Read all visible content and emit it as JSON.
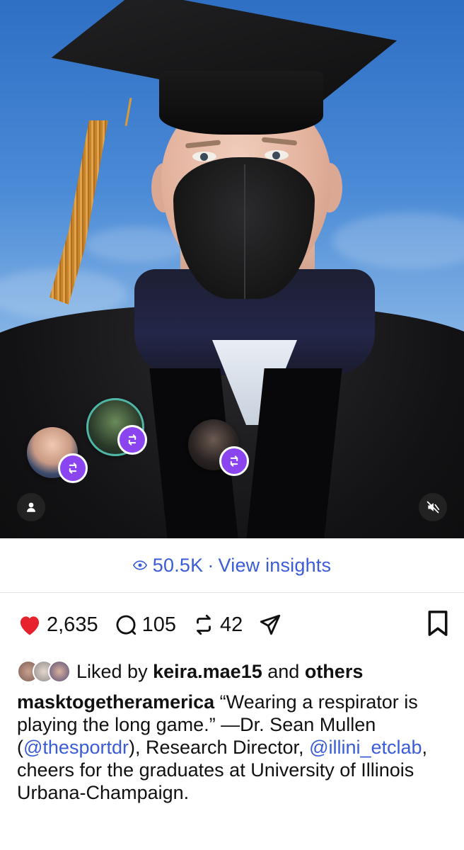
{
  "photo": {
    "description_icons": {
      "user_tag_icon": "person-icon",
      "mute_icon": "speaker-muted-icon"
    }
  },
  "reposter_avatars": [
    {
      "name": "reposter-avatar-1",
      "badge_icon": "repost-icon"
    },
    {
      "name": "reposter-avatar-2",
      "badge_icon": "repost-icon"
    },
    {
      "name": "reposter-avatar-3",
      "badge_icon": "repost-icon"
    }
  ],
  "insights": {
    "views": "50.5K",
    "separator": "·",
    "link_label": "View insights"
  },
  "actions": {
    "likes_count": "2,635",
    "comments_count": "105",
    "reposts_count": "42",
    "like_color": "#e8212f"
  },
  "liked_by": {
    "prefix": "Liked by",
    "user": "keira.mae15",
    "middle": "and",
    "others": "others"
  },
  "caption": {
    "username": "masktogetheramerica",
    "text_1": "“Wearing a respirator is playing the long game.” —Dr. Sean Mullen (",
    "mention_1": "@thesportdr",
    "text_2": "), Research Director, ",
    "mention_2": "@illini_etclab",
    "text_3": ", cheers for the graduates at University of Illinois Urbana-Champaign."
  },
  "colors": {
    "accent": "#3a5cd8",
    "repost_badge": "#8b45f0"
  }
}
